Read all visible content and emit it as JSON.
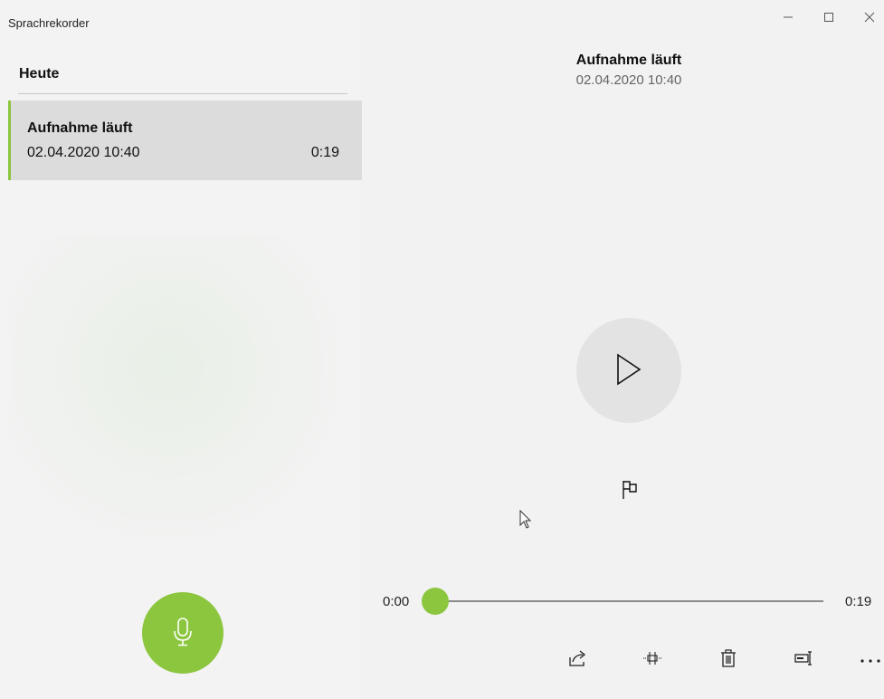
{
  "window": {
    "title": "Sprachrekorder",
    "controls": [
      "minimize-icon",
      "maximize-icon",
      "close-icon"
    ]
  },
  "sidebar": {
    "section_heading": "Heute",
    "recordings": [
      {
        "name": "Aufnahme läuft",
        "date": "02.04.2020 10:40",
        "duration": "0:19",
        "selected": true
      }
    ],
    "record_button_icon": "microphone-icon"
  },
  "detail": {
    "title": "Aufnahme läuft",
    "date": "02.04.2020 10:40",
    "play_icon": "play-icon",
    "marker_icon": "flag-icon",
    "playback": {
      "current_time": "0:00",
      "total_time": "0:19",
      "progress": 0
    },
    "toolbar_icons": [
      "share-icon",
      "trim-icon",
      "delete-icon",
      "rename-icon",
      "more-icon"
    ]
  },
  "colors": {
    "accent": "#8cc63f",
    "selected_item_bg": "#dcdcdc",
    "play_button_bg": "#e3e3e3",
    "background": "#f2f2f2"
  }
}
